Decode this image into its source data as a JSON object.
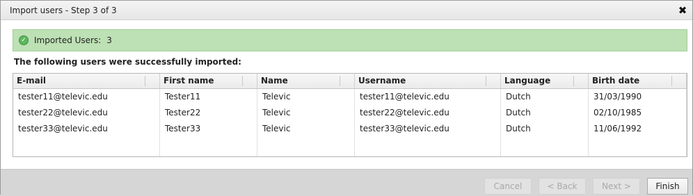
{
  "dialog": {
    "title": "Import users - Step 3 of 3",
    "close_glyph": "✕"
  },
  "status": {
    "icon": "check-circle-icon",
    "label": "Imported Users:",
    "value": "3",
    "color": "#bde0b4"
  },
  "caption": "The following users were successfully imported:",
  "table": {
    "columns": [
      "E-mail",
      "First name",
      "Name",
      "Username",
      "Language",
      "Birth date"
    ],
    "rows": [
      [
        "tester11@televic.edu",
        "Tester11",
        "Televic",
        "tester11@televic.edu",
        "Dutch",
        "31/03/1990"
      ],
      [
        "tester22@televic.edu",
        "Tester22",
        "Televic",
        "tester22@televic.edu",
        "Dutch",
        "02/10/1985"
      ],
      [
        "tester33@televic.edu",
        "Tester33",
        "Televic",
        "tester33@televic.edu",
        "Dutch",
        "11/06/1992"
      ]
    ]
  },
  "buttons": {
    "cancel": "Cancel",
    "back": "< Back",
    "next": "Next >",
    "finish": "Finish"
  }
}
